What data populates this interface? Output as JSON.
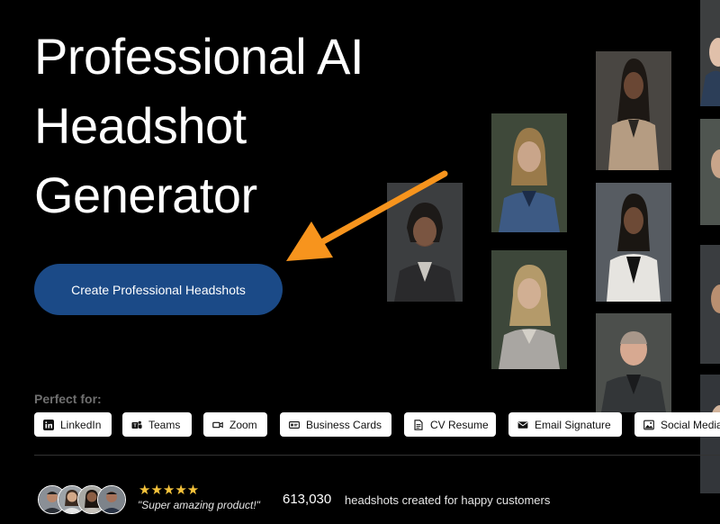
{
  "hero": {
    "title_line1": "Professional AI",
    "title_line2": "Headshot",
    "title_line3": "Generator"
  },
  "cta": {
    "label": "Create Professional Headshots"
  },
  "perfect_for": {
    "label": "Perfect for:",
    "chips": [
      {
        "label": "LinkedIn",
        "icon": "linkedin-icon"
      },
      {
        "label": "Teams",
        "icon": "teams-icon"
      },
      {
        "label": "Zoom",
        "icon": "zoom-icon"
      },
      {
        "label": "Business Cards",
        "icon": "business-card-icon"
      },
      {
        "label": "CV Resume",
        "icon": "document-icon"
      },
      {
        "label": "Email Signature",
        "icon": "email-icon"
      },
      {
        "label": "Social Media",
        "icon": "image-icon"
      }
    ]
  },
  "social_proof": {
    "stars": "★★★★★",
    "rating_value": 5,
    "quote": "\"Super amazing product!\"",
    "count": "613,030",
    "count_text": "headshots created for happy customers"
  },
  "colors": {
    "background": "#000000",
    "cta": "#1b4a87",
    "arrow": "#f7941d",
    "star": "#f5c33b"
  }
}
